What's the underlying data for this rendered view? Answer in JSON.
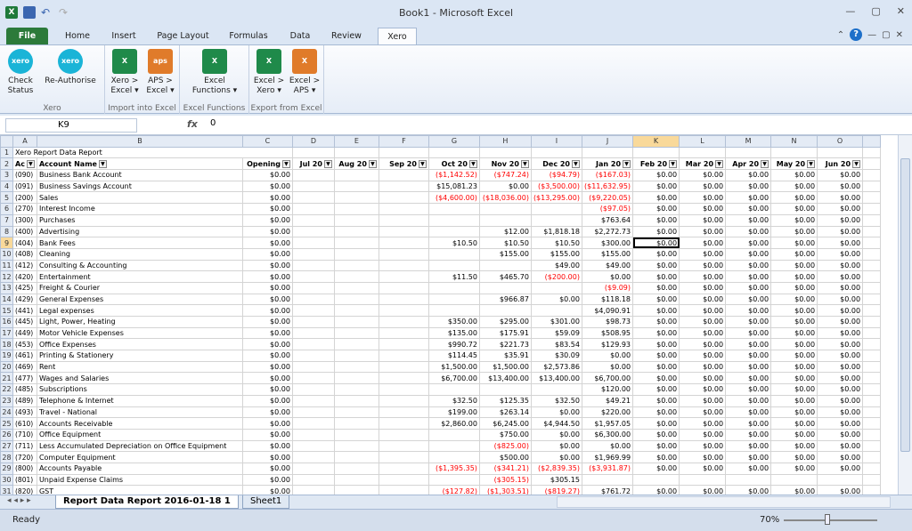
{
  "window": {
    "title": "Book1  -  Microsoft Excel"
  },
  "ribbon_tabs": [
    "File",
    "Home",
    "Insert",
    "Page Layout",
    "Formulas",
    "Data",
    "Review",
    "Xero"
  ],
  "ribbon": {
    "groups": [
      {
        "label": "Xero",
        "buttons": [
          "Check Status",
          "Re-Authorise"
        ]
      },
      {
        "label": "Import into Excel",
        "buttons": [
          "Xero > Excel ▾",
          "APS > Excel ▾"
        ]
      },
      {
        "label": "Excel Functions",
        "buttons": [
          "Excel Functions ▾"
        ]
      },
      {
        "label": "Export from Excel",
        "buttons": [
          "Excel > Xero ▾",
          "Excel > APS ▾"
        ]
      }
    ]
  },
  "formula_bar": {
    "name_box": "K9",
    "fx": "fx",
    "value": "0"
  },
  "columns": [
    "A",
    "B",
    "C",
    "D",
    "E",
    "F",
    "G",
    "H",
    "I",
    "J",
    "K",
    "L",
    "M",
    "N",
    "O"
  ],
  "title_row": "Xero Report Data Report",
  "headers": [
    "Ac",
    "Account Name",
    "Opening",
    "Jul 20",
    "Aug 20",
    "Sep 20",
    "Oct 20",
    "Nov 20",
    "Dec 20",
    "Jan 20",
    "Feb 20",
    "Mar 20",
    "Apr 20",
    "May 20",
    "Jun 20"
  ],
  "rows": [
    [
      "090",
      "Business Bank Account",
      "$0.00",
      "",
      "",
      "",
      "($1,142.52)",
      "($747.24)",
      "($94.79)",
      "($167.03)",
      "$0.00",
      "$0.00",
      "$0.00",
      "$0.00",
      "$0.00"
    ],
    [
      "091",
      "Business Savings Account",
      "$0.00",
      "",
      "",
      "",
      "$15,081.23",
      "$0.00",
      "($3,500.00)",
      "($11,632.95)",
      "$0.00",
      "$0.00",
      "$0.00",
      "$0.00",
      "$0.00"
    ],
    [
      "200",
      "Sales",
      "$0.00",
      "",
      "",
      "",
      "($4,600.00)",
      "($18,036.00)",
      "($13,295.00)",
      "($9,220.05)",
      "$0.00",
      "$0.00",
      "$0.00",
      "$0.00",
      "$0.00"
    ],
    [
      "270",
      "Interest Income",
      "$0.00",
      "",
      "",
      "",
      "",
      "",
      "",
      "($97.05)",
      "$0.00",
      "$0.00",
      "$0.00",
      "$0.00",
      "$0.00"
    ],
    [
      "300",
      "Purchases",
      "$0.00",
      "",
      "",
      "",
      "",
      "",
      "",
      "$763.64",
      "$0.00",
      "$0.00",
      "$0.00",
      "$0.00",
      "$0.00"
    ],
    [
      "400",
      "Advertising",
      "$0.00",
      "",
      "",
      "",
      "",
      "$12.00",
      "$1,818.18",
      "$2,272.73",
      "$0.00",
      "$0.00",
      "$0.00",
      "$0.00",
      "$0.00"
    ],
    [
      "404",
      "Bank Fees",
      "$0.00",
      "",
      "",
      "",
      "$10.50",
      "$10.50",
      "$10.50",
      "$300.00",
      "$0.00",
      "$0.00",
      "$0.00",
      "$0.00",
      "$0.00"
    ],
    [
      "408",
      "Cleaning",
      "$0.00",
      "",
      "",
      "",
      "",
      "$155.00",
      "$155.00",
      "$155.00",
      "$0.00",
      "$0.00",
      "$0.00",
      "$0.00",
      "$0.00"
    ],
    [
      "412",
      "Consulting & Accounting",
      "$0.00",
      "",
      "",
      "",
      "",
      "",
      "$49.00",
      "$49.00",
      "$0.00",
      "$0.00",
      "$0.00",
      "$0.00",
      "$0.00"
    ],
    [
      "420",
      "Entertainment",
      "$0.00",
      "",
      "",
      "",
      "$11.50",
      "$465.70",
      "($200.00)",
      "$0.00",
      "$0.00",
      "$0.00",
      "$0.00",
      "$0.00",
      "$0.00"
    ],
    [
      "425",
      "Freight & Courier",
      "$0.00",
      "",
      "",
      "",
      "",
      "",
      "",
      "($9.09)",
      "$0.00",
      "$0.00",
      "$0.00",
      "$0.00",
      "$0.00"
    ],
    [
      "429",
      "General Expenses",
      "$0.00",
      "",
      "",
      "",
      "",
      "$966.87",
      "$0.00",
      "$118.18",
      "$0.00",
      "$0.00",
      "$0.00",
      "$0.00",
      "$0.00"
    ],
    [
      "441",
      "Legal expenses",
      "$0.00",
      "",
      "",
      "",
      "",
      "",
      "",
      "$4,090.91",
      "$0.00",
      "$0.00",
      "$0.00",
      "$0.00",
      "$0.00"
    ],
    [
      "445",
      "Light, Power, Heating",
      "$0.00",
      "",
      "",
      "",
      "$350.00",
      "$295.00",
      "$301.00",
      "$98.73",
      "$0.00",
      "$0.00",
      "$0.00",
      "$0.00",
      "$0.00"
    ],
    [
      "449",
      "Motor Vehicle Expenses",
      "$0.00",
      "",
      "",
      "",
      "$135.00",
      "$175.91",
      "$59.09",
      "$508.95",
      "$0.00",
      "$0.00",
      "$0.00",
      "$0.00",
      "$0.00"
    ],
    [
      "453",
      "Office Expenses",
      "$0.00",
      "",
      "",
      "",
      "$990.72",
      "$221.73",
      "$83.54",
      "$129.93",
      "$0.00",
      "$0.00",
      "$0.00",
      "$0.00",
      "$0.00"
    ],
    [
      "461",
      "Printing & Stationery",
      "$0.00",
      "",
      "",
      "",
      "$114.45",
      "$35.91",
      "$30.09",
      "$0.00",
      "$0.00",
      "$0.00",
      "$0.00",
      "$0.00",
      "$0.00"
    ],
    [
      "469",
      "Rent",
      "$0.00",
      "",
      "",
      "",
      "$1,500.00",
      "$1,500.00",
      "$2,573.86",
      "$0.00",
      "$0.00",
      "$0.00",
      "$0.00",
      "$0.00",
      "$0.00"
    ],
    [
      "477",
      "Wages and Salaries",
      "$0.00",
      "",
      "",
      "",
      "$6,700.00",
      "$13,400.00",
      "$13,400.00",
      "$6,700.00",
      "$0.00",
      "$0.00",
      "$0.00",
      "$0.00",
      "$0.00"
    ],
    [
      "485",
      "Subscriptions",
      "$0.00",
      "",
      "",
      "",
      "",
      "",
      "",
      "$120.00",
      "$0.00",
      "$0.00",
      "$0.00",
      "$0.00",
      "$0.00"
    ],
    [
      "489",
      "Telephone & Internet",
      "$0.00",
      "",
      "",
      "",
      "$32.50",
      "$125.35",
      "$32.50",
      "$49.21",
      "$0.00",
      "$0.00",
      "$0.00",
      "$0.00",
      "$0.00"
    ],
    [
      "493",
      "Travel - National",
      "$0.00",
      "",
      "",
      "",
      "$199.00",
      "$263.14",
      "$0.00",
      "$220.00",
      "$0.00",
      "$0.00",
      "$0.00",
      "$0.00",
      "$0.00"
    ],
    [
      "610",
      "Accounts Receivable",
      "$0.00",
      "",
      "",
      "",
      "$2,860.00",
      "$6,245.00",
      "$4,944.50",
      "$1,957.05",
      "$0.00",
      "$0.00",
      "$0.00",
      "$0.00",
      "$0.00"
    ],
    [
      "710",
      "Office Equipment",
      "$0.00",
      "",
      "",
      "",
      "",
      "$750.00",
      "$0.00",
      "$6,300.00",
      "$0.00",
      "$0.00",
      "$0.00",
      "$0.00",
      "$0.00"
    ],
    [
      "711",
      "Less Accumulated Depreciation on Office Equipment",
      "$0.00",
      "",
      "",
      "",
      "",
      "($825.00)",
      "$0.00",
      "$0.00",
      "$0.00",
      "$0.00",
      "$0.00",
      "$0.00",
      "$0.00"
    ],
    [
      "720",
      "Computer Equipment",
      "$0.00",
      "",
      "",
      "",
      "",
      "$500.00",
      "$0.00",
      "$1,969.99",
      "$0.00",
      "$0.00",
      "$0.00",
      "$0.00",
      "$0.00"
    ],
    [
      "800",
      "Accounts Payable",
      "$0.00",
      "",
      "",
      "",
      "($1,395.35)",
      "($341.21)",
      "($2,839.35)",
      "($3,931.87)",
      "$0.00",
      "$0.00",
      "$0.00",
      "$0.00",
      "$0.00"
    ],
    [
      "801",
      "Unpaid Expense Claims",
      "$0.00",
      "",
      "",
      "",
      "",
      "($305.15)",
      "$305.15",
      "",
      "",
      "",
      "",
      "",
      ""
    ],
    [
      "820",
      "GST",
      "$0.00",
      "",
      "",
      "",
      "($127.82)",
      "($1,303.51)",
      "($819.27)",
      "$761.72",
      "$0.00",
      "$0.00",
      "$0.00",
      "$0.00",
      "$0.00"
    ]
  ],
  "sheet_tabs": [
    "Report Data Report 2016-01-18 1",
    "Sheet1"
  ],
  "status": {
    "ready": "Ready",
    "zoom": "70%"
  }
}
